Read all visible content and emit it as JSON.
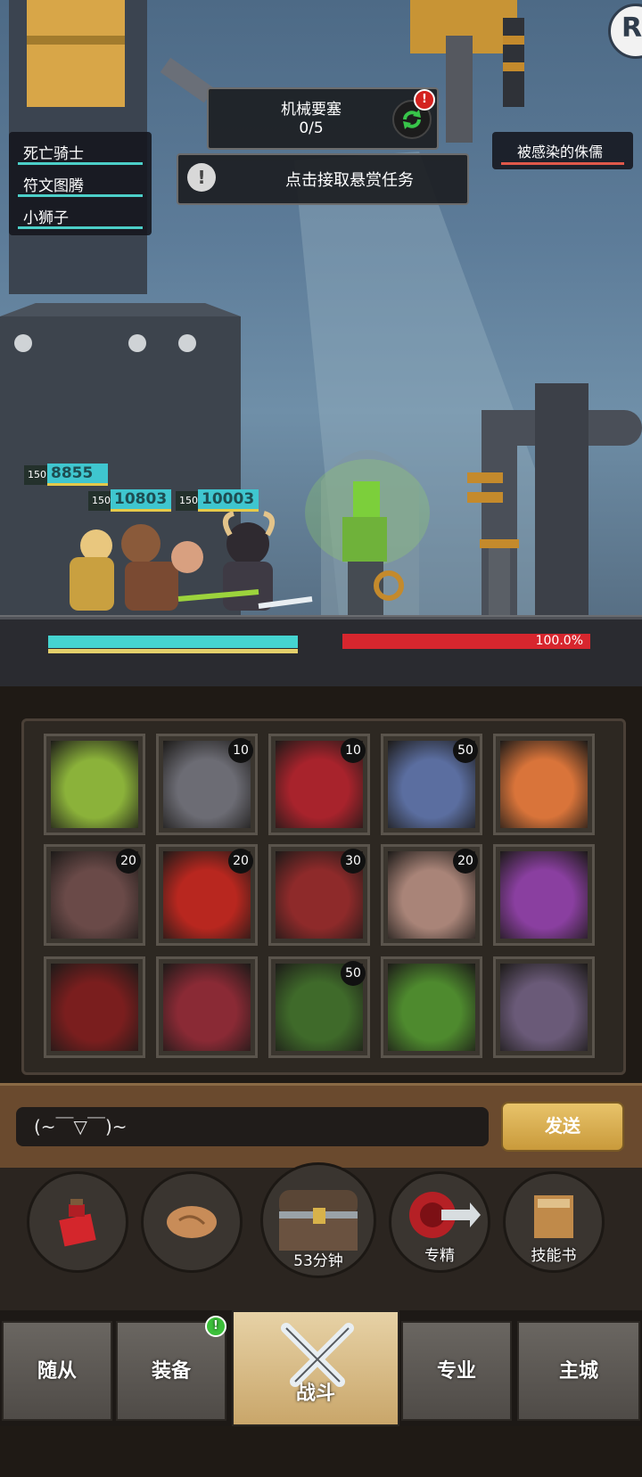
{
  "party": [
    {
      "name": "死亡骑士"
    },
    {
      "name": "符文图腾"
    },
    {
      "name": "小狮子"
    }
  ],
  "enemy": {
    "name": "被感染的侏儒"
  },
  "quest": {
    "name": "机械要塞",
    "progress": "0/5",
    "refresh_badge": "!"
  },
  "bounty": {
    "label": "点击接取悬赏任务",
    "icon": "!"
  },
  "corner_button": {
    "label": "R"
  },
  "units": [
    {
      "level": "150",
      "hp": "8855"
    },
    {
      "level": "150",
      "hp": "10803"
    },
    {
      "level": "150",
      "hp": "10003"
    }
  ],
  "boss": {
    "hp_percent_text": "100.0%",
    "hp_fraction": 1.0
  },
  "team": {
    "hp_fraction": 1.0
  },
  "skills": [
    {
      "icon": "plague-mask-icon",
      "count": "",
      "color": "#8bb23a"
    },
    {
      "icon": "gorilla-lightning-icon",
      "count": "10",
      "color": "#6c6c74"
    },
    {
      "icon": "blood-blade-icon",
      "count": "10",
      "color": "#a8232c"
    },
    {
      "icon": "lightning-staff-icon",
      "count": "50",
      "color": "#5b6ea0"
    },
    {
      "icon": "golden-rune-icon",
      "count": "",
      "color": "#d9743a"
    },
    {
      "icon": "rose-icon",
      "count": "20",
      "color": "#6a4a48"
    },
    {
      "icon": "blood-pool-icon",
      "count": "20",
      "color": "#b8271f"
    },
    {
      "icon": "spiked-gauntlet-icon",
      "count": "30",
      "color": "#8e2a2a"
    },
    {
      "icon": "burst-icon",
      "count": "20",
      "color": "#a98478"
    },
    {
      "icon": "purple-demon-icon",
      "count": "",
      "color": "#8a3fa0"
    },
    {
      "icon": "horned-helm-icon",
      "count": "",
      "color": "#7a1e1e"
    },
    {
      "icon": "fire-heart-icon",
      "count": "",
      "color": "#8a2a35"
    },
    {
      "icon": "green-skull-icon",
      "count": "50",
      "color": "#3f6a2a"
    },
    {
      "icon": "zombie-icon",
      "count": "",
      "color": "#4e8a2e"
    },
    {
      "icon": "skull-pile-icon",
      "count": "",
      "color": "#6a5a78"
    }
  ],
  "chat": {
    "input_text": "(~￣▽￣)~",
    "send_label": "发送"
  },
  "actions": {
    "potion": {
      "icon": "red-potion-icon",
      "label": ""
    },
    "bread": {
      "icon": "bread-icon",
      "label": ""
    },
    "chest": {
      "icon": "treasure-chest-icon",
      "label": "53分钟"
    },
    "specialization": {
      "icon": "red-shield-icon",
      "label": "专精"
    },
    "skillbook": {
      "icon": "skill-book-icon",
      "label": "技能书"
    }
  },
  "nav": {
    "followers": "随从",
    "equipment": "装备",
    "battle": "战斗",
    "profession": "专业",
    "main_city": "主城"
  },
  "nav_badge": "!",
  "colors": {
    "team_hp": "#45d4d0",
    "boss_hp": "#d7262e",
    "send_button": "#e8c36a",
    "accent_gold": "#c99a3b"
  }
}
